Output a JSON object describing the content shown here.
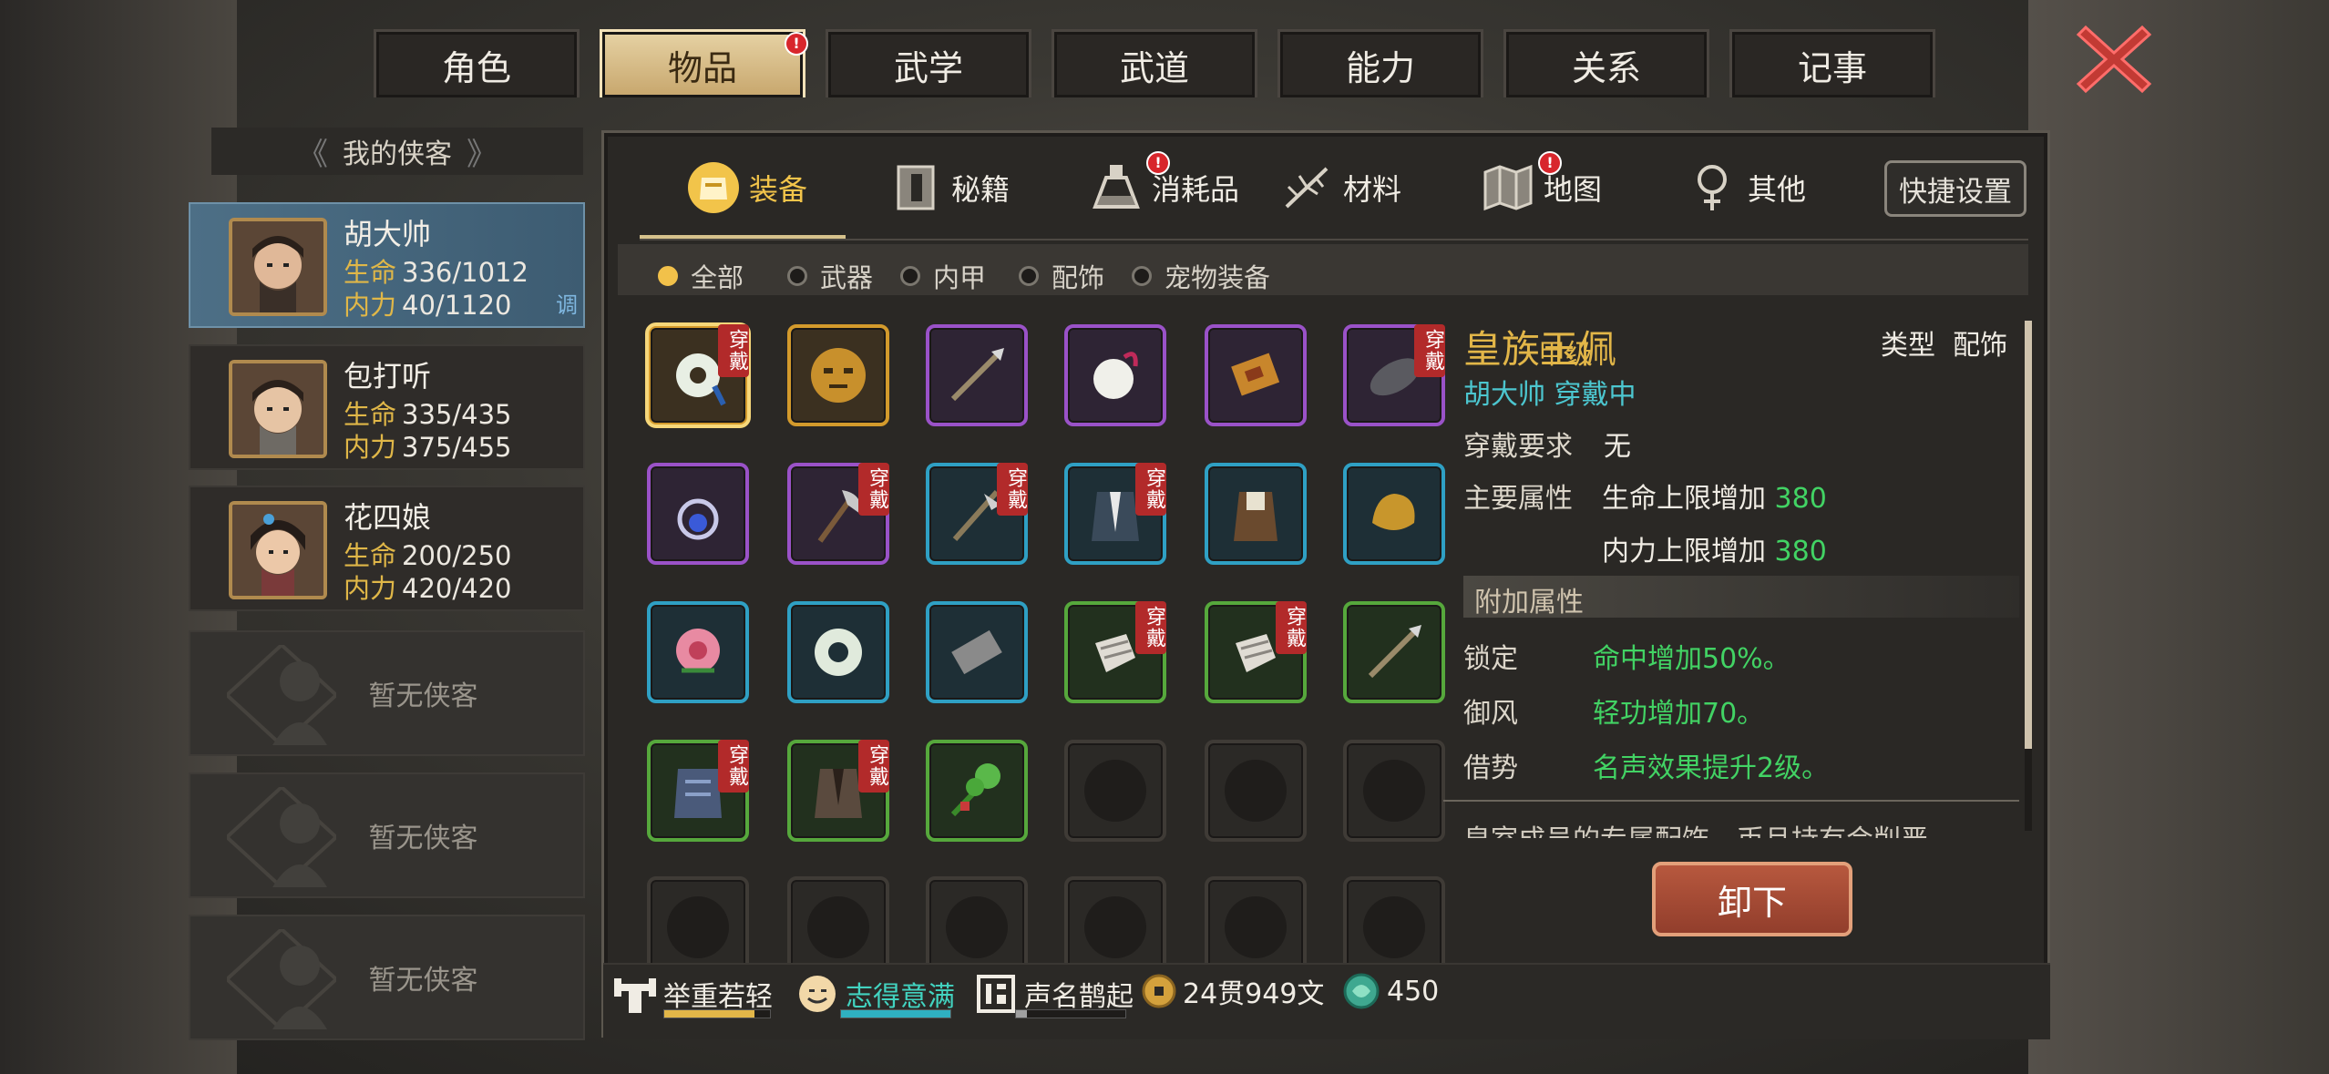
{
  "top_tabs": [
    {
      "label": "角色",
      "active": false,
      "badge": false
    },
    {
      "label": "物品",
      "active": true,
      "badge": true
    },
    {
      "label": "武学",
      "active": false,
      "badge": false
    },
    {
      "label": "武道",
      "active": false,
      "badge": false
    },
    {
      "label": "能力",
      "active": false,
      "badge": false
    },
    {
      "label": "关系",
      "active": false,
      "badge": false
    },
    {
      "label": "记事",
      "active": false,
      "badge": false
    }
  ],
  "badge_mark": "!",
  "left_panel": {
    "header": "我的侠客",
    "arrow_left": "《",
    "arrow_right": "》",
    "characters": [
      {
        "name": "胡大帅",
        "hp_label": "生命",
        "hp": "336/1012",
        "mp_label": "内力",
        "mp": "40/1120",
        "adjust": "调",
        "active": true
      },
      {
        "name": "包打听",
        "hp_label": "生命",
        "hp": "335/435",
        "mp_label": "内力",
        "mp": "375/455",
        "active": false
      },
      {
        "name": "花四娘",
        "hp_label": "生命",
        "hp": "200/250",
        "mp_label": "内力",
        "mp": "420/420",
        "active": false
      }
    ],
    "empty_label": "暂无侠客"
  },
  "category_tabs": [
    {
      "label": "装备",
      "icon": "armor-icon",
      "active": true,
      "badge": false
    },
    {
      "label": "秘籍",
      "icon": "book-icon",
      "active": false,
      "badge": false
    },
    {
      "label": "消耗品",
      "icon": "potion-icon",
      "active": false,
      "badge": true
    },
    {
      "label": "材料",
      "icon": "herb-icon",
      "active": false,
      "badge": false
    },
    {
      "label": "地图",
      "icon": "map-icon",
      "active": false,
      "badge": true
    },
    {
      "label": "其他",
      "icon": "misc-icon",
      "active": false,
      "badge": false
    }
  ],
  "quick_settings": "快捷设置",
  "filters": [
    {
      "label": "全部",
      "on": true
    },
    {
      "label": "武器",
      "on": false
    },
    {
      "label": "内甲",
      "on": false
    },
    {
      "label": "配饰",
      "on": false
    },
    {
      "label": "宠物装备",
      "on": false
    }
  ],
  "equipped_tag": "穿戴",
  "items": [
    {
      "rarity": "gold",
      "icon": "jade-pendant-icon",
      "equipped": true,
      "selected": true
    },
    {
      "rarity": "gold",
      "icon": "mask-icon",
      "equipped": false
    },
    {
      "rarity": "purple",
      "icon": "spear-icon",
      "equipped": false
    },
    {
      "rarity": "purple",
      "icon": "sachet-icon",
      "equipped": false
    },
    {
      "rarity": "purple",
      "icon": "token-icon",
      "equipped": false
    },
    {
      "rarity": "purple",
      "icon": "blade-icon",
      "equipped": true
    },
    {
      "rarity": "purple",
      "icon": "amulet-icon",
      "equipped": false
    },
    {
      "rarity": "purple",
      "icon": "axe-icon",
      "equipped": true
    },
    {
      "rarity": "blue",
      "icon": "halberd-icon",
      "equipped": true
    },
    {
      "rarity": "blue",
      "icon": "robe-icon",
      "equipped": true
    },
    {
      "rarity": "blue",
      "icon": "vest-icon",
      "equipped": false
    },
    {
      "rarity": "blue",
      "icon": "ore-icon",
      "equipped": false
    },
    {
      "rarity": "blue",
      "icon": "flower-icon",
      "equipped": false
    },
    {
      "rarity": "blue",
      "icon": "jade-ring-icon",
      "equipped": false
    },
    {
      "rarity": "blue",
      "icon": "stone-icon",
      "equipped": false
    },
    {
      "rarity": "green",
      "icon": "gauntlet-icon",
      "equipped": true
    },
    {
      "rarity": "green",
      "icon": "gauntlet-icon",
      "equipped": true
    },
    {
      "rarity": "green",
      "icon": "spear-icon",
      "equipped": false
    },
    {
      "rarity": "green",
      "icon": "armor-vest-icon",
      "equipped": true
    },
    {
      "rarity": "green",
      "icon": "cloth-robe-icon",
      "equipped": true
    },
    {
      "rarity": "green",
      "icon": "herb-bundle-icon",
      "equipped": false
    }
  ],
  "detail": {
    "name": "皇族玉佩",
    "grade": "甲级",
    "type_label": "类型",
    "type_value": "配饰",
    "wearer": "胡大帅 穿戴中",
    "req_label": "穿戴要求",
    "req_value": "无",
    "main_label": "主要属性",
    "main_attrs": [
      {
        "text": "生命上限增加",
        "value": "380"
      },
      {
        "text": "内力上限增加",
        "value": "380"
      }
    ],
    "extra_title": "附加属性",
    "extra_attrs": [
      {
        "name": "锁定",
        "text": "命中增加50%。"
      },
      {
        "name": "御风",
        "text": "轻功增加70。"
      },
      {
        "name": "借势",
        "text": "名声效果提升2级。"
      }
    ],
    "description_partial": "皇室成员的专属配饰，币且持有会削严",
    "scroll_fraction": 0.84,
    "unequip_label": "卸下"
  },
  "bottom_bar": {
    "items": [
      {
        "label": "举重若轻",
        "icon": "strength-icon",
        "color": "#f0ece4",
        "bar_color": "#e2b648",
        "fill": 0.85
      },
      {
        "label": "志得意满",
        "icon": "smile-icon",
        "color": "#42d3c0",
        "bar_color": "#2fb0c0",
        "fill": 1.0
      },
      {
        "label": "声名鹊起",
        "icon": "fame-icon",
        "color": "#f0ece4",
        "bar_color": "#a0a0a0",
        "fill": 0.1
      }
    ],
    "money": "24贯949文",
    "jade": "450"
  },
  "colors": {
    "accent": "#e2b648",
    "equipped_tag": "#b22a2a",
    "positive": "#42d364",
    "wearer": "#4cc6cf"
  }
}
